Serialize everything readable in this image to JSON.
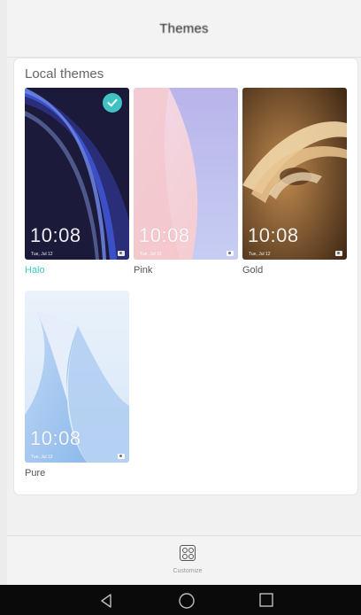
{
  "app": {
    "title": "Themes"
  },
  "section": {
    "title": "Local themes"
  },
  "themes": [
    {
      "name": "Halo",
      "time": "10:08",
      "date": "Tue, Jul 12",
      "selected": true
    },
    {
      "name": "Pink",
      "time": "10:08",
      "date": "Tue, Jul 12",
      "selected": false
    },
    {
      "name": "Gold",
      "time": "10:08",
      "date": "Tue, Jul 12",
      "selected": false
    },
    {
      "name": "Pure",
      "time": "10:08",
      "date": "Tue, Jul 12",
      "selected": false
    }
  ],
  "bottom": {
    "customize_label": "Customize"
  },
  "colors": {
    "accent": "#3fc8c9",
    "nav_bar": "#0a0a0a"
  },
  "icons": {
    "selected": "check-icon",
    "customize": "customize-icon",
    "back": "back-triangle-icon",
    "home": "home-circle-icon",
    "recents": "recents-square-icon",
    "lock_camera": "camera-icon"
  }
}
